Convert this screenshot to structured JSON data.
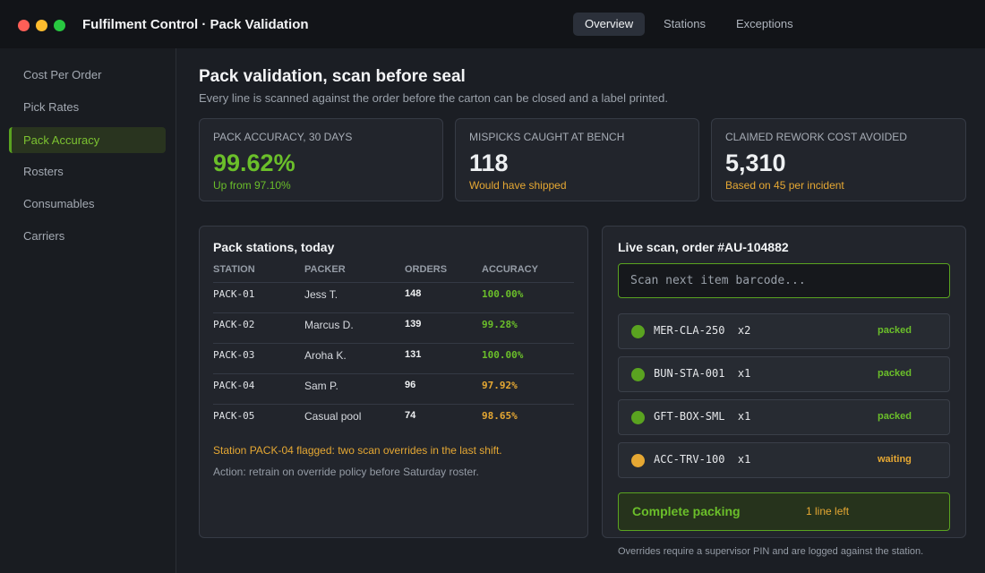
{
  "window": {
    "title": "Fulfilment Control · Pack Validation"
  },
  "topnav": [
    "Overview",
    "Stations",
    "Exceptions"
  ],
  "sidebar": [
    "Cost Per Order",
    "Pick Rates",
    "Pack Accuracy",
    "Rosters",
    "Consumables",
    "Carriers"
  ],
  "page": {
    "title": "Pack validation, scan before seal",
    "subtitle": "Every line is scanned against the order before the carton can be closed and a label printed."
  },
  "kpis": [
    {
      "label": "PACK ACCURACY, 30 DAYS",
      "value": "99.62%",
      "note": "Up from 97.10%"
    },
    {
      "label": "MISPICKS CAUGHT AT BENCH",
      "value": "118",
      "note": "Would have shipped"
    },
    {
      "label": "CLAIMED REWORK COST AVOIDED",
      "value": "5,310",
      "note": "Based on 45 per incident"
    }
  ],
  "stations": {
    "title": "Pack stations, today",
    "columns": [
      "STATION",
      "PACKER",
      "ORDERS",
      "ACCURACY"
    ],
    "rows": [
      {
        "station": "PACK-01",
        "packer": "Jess T.",
        "orders": "148",
        "accuracy": "100.00%"
      },
      {
        "station": "PACK-02",
        "packer": "Marcus D.",
        "orders": "139",
        "accuracy": "99.28%"
      },
      {
        "station": "PACK-03",
        "packer": "Aroha K.",
        "orders": "131",
        "accuracy": "100.00%"
      },
      {
        "station": "PACK-04",
        "packer": "Sam P.",
        "orders": "96",
        "accuracy": "97.92%"
      },
      {
        "station": "PACK-05",
        "packer": "Casual pool",
        "orders": "74",
        "accuracy": "98.65%"
      }
    ],
    "flag": "Station PACK-04 flagged: two scan overrides in the last shift.",
    "action": "Action: retrain on override policy before Saturday roster."
  },
  "scan": {
    "title": "Live scan, order #AU-104882",
    "placeholder": "Scan next item barcode...",
    "items": [
      {
        "sku": "MER-CLA-250  x2",
        "status": "packed"
      },
      {
        "sku": "BUN-STA-001  x1",
        "status": "packed"
      },
      {
        "sku": "GFT-BOX-SML  x1",
        "status": "packed"
      },
      {
        "sku": "ACC-TRV-100  x1",
        "status": "waiting"
      }
    ],
    "complete_label": "Complete packing",
    "lines_left": "1 line left",
    "footnote": "Overrides require a supervisor PIN and are logged against the station."
  },
  "colors": {
    "accent": "#5aa320",
    "ok": "#6bbf2a",
    "warn": "#e6a833"
  }
}
